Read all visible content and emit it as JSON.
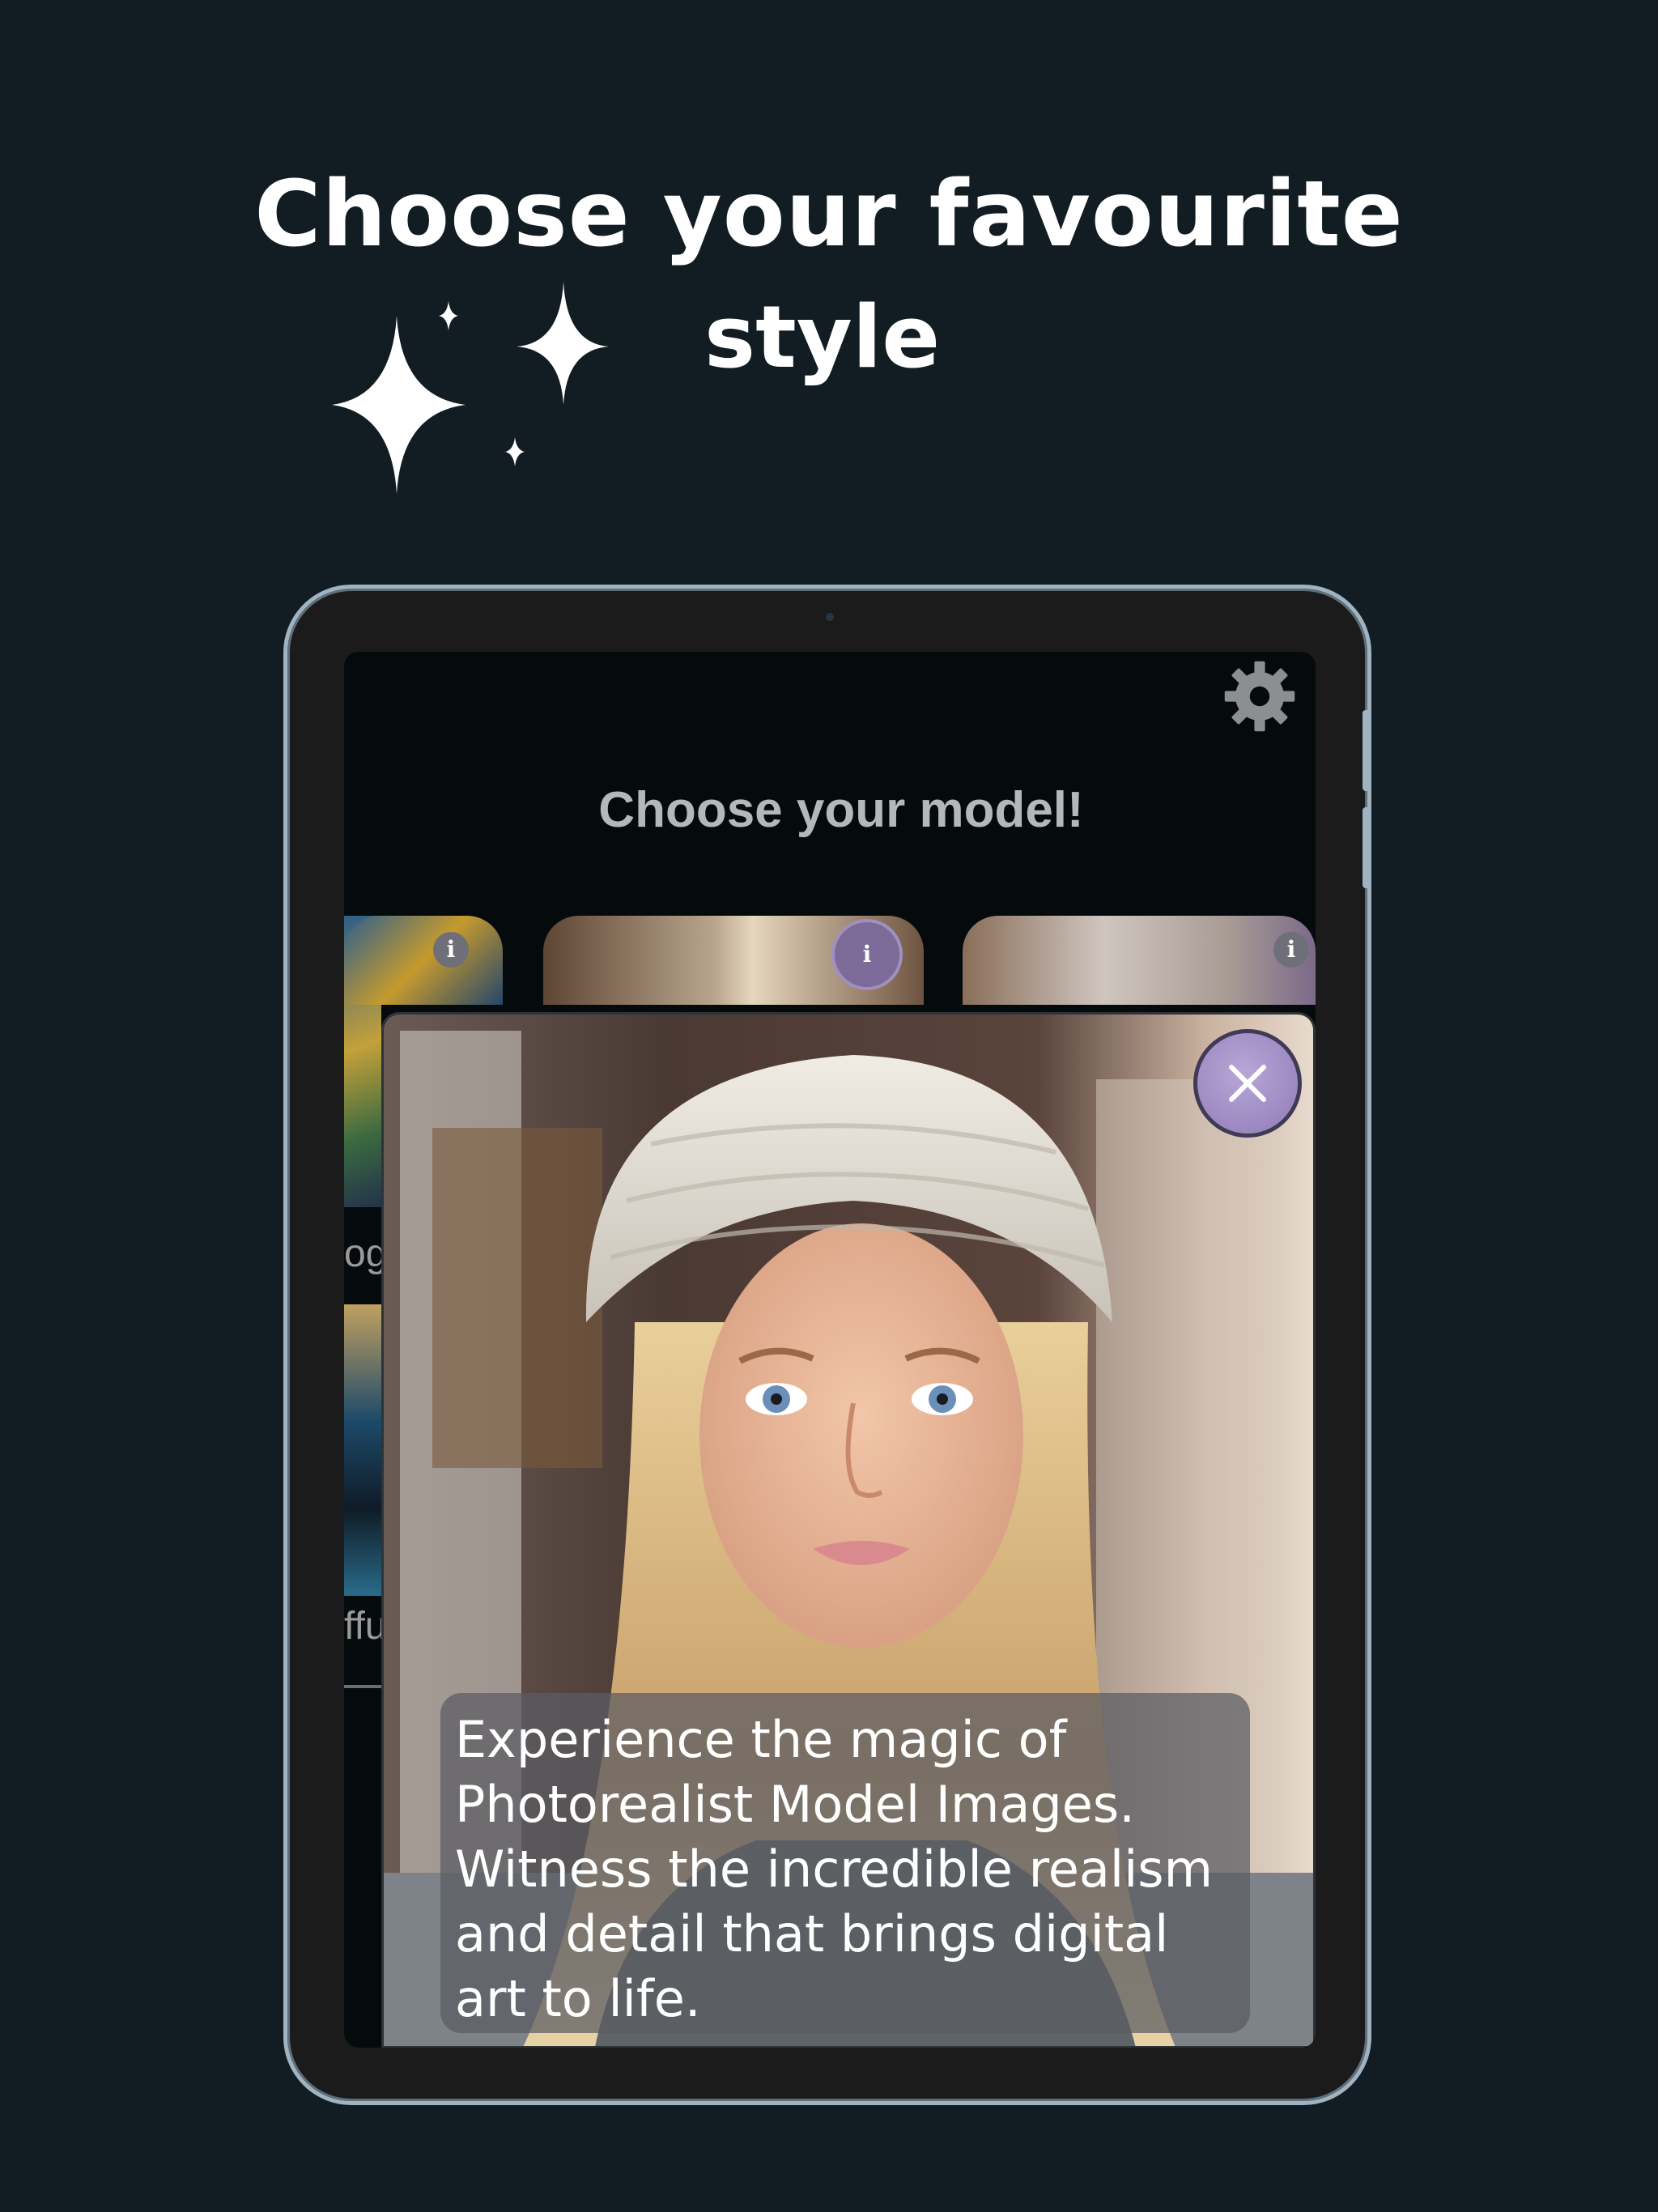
{
  "headline": {
    "line1": "Choose your favourite",
    "line2": "style"
  },
  "app": {
    "title": "Choose your model!",
    "strip_labels": [
      "og",
      "ffu"
    ],
    "info_glyph": "i",
    "popup": {
      "caption": "Experience the magic of Photorealist Model Images. Witness the incredible realism and detail that brings digital art to life."
    }
  },
  "icons": {
    "settings": "gear-icon",
    "close": "close-icon",
    "info": "info-icon",
    "sparkles": "sparkles-icon"
  },
  "colors": {
    "background": "#111c23",
    "screen": "#050a0d",
    "accent_purple": "#a18fc0",
    "device_frame": "#9fb3c0"
  }
}
